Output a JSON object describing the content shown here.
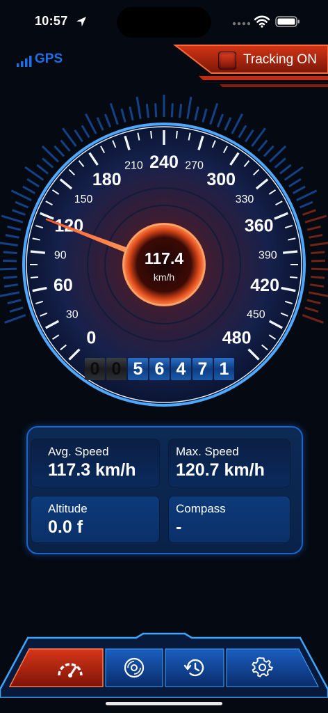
{
  "status_bar": {
    "time": "10:57"
  },
  "gps": {
    "label": "GPS"
  },
  "tracking": {
    "label": "Tracking ON"
  },
  "gauge": {
    "value": 117.4,
    "value_text": "117.4",
    "unit": "km/h",
    "max": 480,
    "labels": [
      "0",
      "30",
      "60",
      "90",
      "120",
      "150",
      "180",
      "210",
      "240",
      "270",
      "300",
      "330",
      "360",
      "390",
      "420",
      "450",
      "480"
    ]
  },
  "odometer": {
    "digits": [
      "0",
      "0",
      "5",
      "6",
      "4",
      "7",
      "1"
    ]
  },
  "stats": {
    "avg_speed_label": "Avg. Speed",
    "avg_speed_value": "117.3 km/h",
    "max_speed_label": "Max. Speed",
    "max_speed_value": "120.7 km/h",
    "altitude_label": "Altitude",
    "altitude_value": "0.0 f",
    "compass_label": "Compass",
    "compass_value": "-"
  },
  "nav": {
    "items": [
      {
        "icon": "speedometer-icon",
        "active": true
      },
      {
        "icon": "disc-icon",
        "active": false
      },
      {
        "icon": "history-icon",
        "active": false
      },
      {
        "icon": "settings-icon",
        "active": false
      }
    ]
  },
  "colors": {
    "accent_blue": "#1f6fe8",
    "accent_red": "#e0301a",
    "background": "#050a12"
  }
}
